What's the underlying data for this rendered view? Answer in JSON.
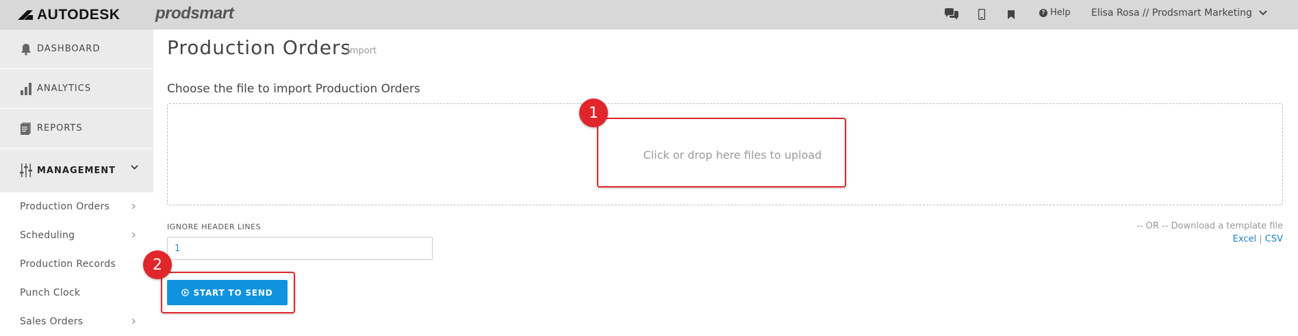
{
  "header": {
    "brand": "AUTODESK",
    "product": "prodsmart",
    "icons": [
      "chat-icon",
      "mobile-icon",
      "bookmark-icon"
    ],
    "help_label": "Help",
    "user_label": "Elisa Rosa // Prodsmart Marketing"
  },
  "sidebar": {
    "main_items": [
      {
        "label": "DASHBOARD",
        "icon": "bell-icon"
      },
      {
        "label": "ANALYTICS",
        "icon": "bar-chart-icon"
      },
      {
        "label": "REPORTS",
        "icon": "document-icon"
      }
    ],
    "section": {
      "label": "MANAGEMENT",
      "icon": "sliders-icon"
    },
    "sub_items": [
      {
        "label": "Production Orders",
        "has_arrow": true
      },
      {
        "label": "Scheduling",
        "has_arrow": true
      },
      {
        "label": "Production Records",
        "has_arrow": false
      },
      {
        "label": "Punch Clock",
        "has_arrow": false
      },
      {
        "label": "Sales Orders",
        "has_arrow": true
      }
    ]
  },
  "main": {
    "title": "Production Orders",
    "subtitle": "Import",
    "choose_label": "Choose the file to import Production Orders",
    "dropzone_text": "Click or drop here files to upload",
    "ignore_label": "IGNORE HEADER LINES",
    "ignore_value": "1",
    "or_text": "-- OR -- Download a template file",
    "template_links": {
      "excel": "Excel",
      "separator": "|",
      "csv": "CSV"
    },
    "send_button": "START TO SEND"
  },
  "annotations": [
    {
      "number": "1"
    },
    {
      "number": "2"
    }
  ],
  "colors": {
    "accent": "#0f93de",
    "annotation": "#e0262b",
    "topbar": "#d8d8d8",
    "sidebar_active": "#ebebeb",
    "link": "#1e7fc2"
  }
}
